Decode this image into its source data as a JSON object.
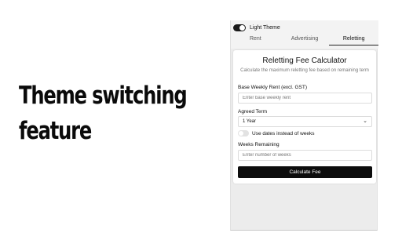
{
  "headline": {
    "line1": "Theme switching",
    "line2": "feature"
  },
  "theme": {
    "label": "Light Theme",
    "enabled": true
  },
  "tabs": [
    {
      "label": "Rent",
      "active": false
    },
    {
      "label": "Advertising",
      "active": false
    },
    {
      "label": "Reletting",
      "active": true
    }
  ],
  "calculator": {
    "title": "Reletting Fee Calculator",
    "subtitle": "Calculate the maximum reletting fee based on remaining term",
    "weekly_rent": {
      "label": "Base Weekly Rent (excl. GST)",
      "placeholder": "Enter base weekly rent",
      "value": ""
    },
    "agreed_term": {
      "label": "Agreed Term",
      "selected": "1 Year"
    },
    "use_dates": {
      "label": "Use dates instead of weeks",
      "enabled": false
    },
    "weeks_remaining": {
      "label": "Weeks Remaining",
      "placeholder": "Enter number of weeks",
      "value": ""
    },
    "submit_label": "Calculate Fee"
  },
  "colors": {
    "accent": "#0d0d0d",
    "panel_background": "#ececec",
    "card_background": "#ffffff"
  },
  "icons": {
    "select_arrow": "chevron-down-icon"
  }
}
